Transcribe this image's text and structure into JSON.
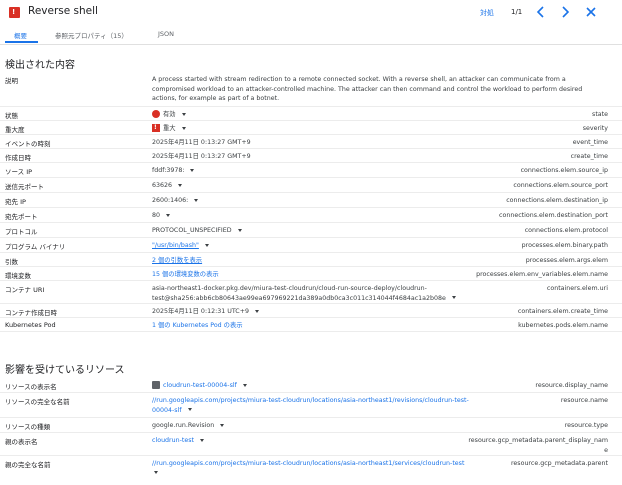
{
  "header": {
    "severity_glyph": "!",
    "title": "Reverse shell",
    "action_link": "対処",
    "pager": "1/1"
  },
  "tabs": [
    {
      "label": "概要"
    },
    {
      "label": "参照元プロパティ（15）"
    },
    {
      "label": "JSON"
    }
  ],
  "details": {
    "title": "検出された内容",
    "rows": [
      {
        "label": "説明",
        "value": "A process started with stream redirection to a remote connected socket. With a reverse shell, an attacker can communicate from a compromised workload to an attacker-controlled machine. The attacker can then command and control the workload to perform desired actions, for example as part of a botnet.",
        "field": ""
      },
      {
        "label": "状態",
        "value": "有効",
        "field": "state"
      },
      {
        "label": "重大度",
        "value": "重大",
        "field": "severity"
      },
      {
        "label": "イベントの時刻",
        "value": "2025年4月11日 0:13:27 GMT+9",
        "field": "event_time"
      },
      {
        "label": "作成日時",
        "value": "2025年4月11日 0:13:27 GMT+9",
        "field": "create_time"
      },
      {
        "label": "ソース IP",
        "value": "fddf:3978:",
        "field": "connections.elem.source_ip"
      },
      {
        "label": "送信元ポート",
        "value": "63626",
        "field": "connections.elem.source_port"
      },
      {
        "label": "宛先 IP",
        "value": "2600:1406:",
        "field": "connections.elem.destination_ip"
      },
      {
        "label": "宛先ポート",
        "value": "80",
        "field": "connections.elem.destination_port"
      },
      {
        "label": "プロトコル",
        "value": "PROTOCOL_UNSPECIFIED",
        "field": "connections.elem.protocol"
      },
      {
        "label": "プログラム バイナリ",
        "value": "\"/usr/bin/bash\"",
        "field": "processes.elem.binary.path"
      },
      {
        "label": "引数",
        "value": "2 個の引数を表示",
        "field": "processes.elem.args.elem"
      },
      {
        "label": "環境変数",
        "value": "15 個の環境変数の表示",
        "field": "processes.elem.env_variables.elem.name"
      },
      {
        "label": "コンテナ URI",
        "value_line1": "asia-northeast1-docker.pkg.dev/miura-test-cloudrun/cloud-run-source-deploy/cloudrun-",
        "value_line2": "test@sha256:abb6cb80643ae99ea697969221da389a0db0ca3c011c314044f4684ac1a2b08e",
        "field": "containers.elem.uri"
      },
      {
        "label": "コンテナ作成日時",
        "value": "2025年4月11日 0:12:31 UTC+9",
        "field": "containers.elem.create_time"
      },
      {
        "label": "Kubernetes Pod",
        "value": "1 個の Kubernetes Pod の表示",
        "field": "kubernetes.pods.elem.name"
      }
    ]
  },
  "resource": {
    "title": "影響を受けているリソース",
    "rows": [
      {
        "label": "リソースの表示名",
        "value": "cloudrun-test-00004-slf",
        "field": "resource.display_name"
      },
      {
        "label": "リソースの完全な名前",
        "value_line1": "//run.googleapis.com/projects/miura-test-cloudrun/locations/asia-northeast1/revisions/cloudrun-test-",
        "value_line2": "00004-slf",
        "field": "resource.name"
      },
      {
        "label": "リソースの種類",
        "value": "google.run.Revision",
        "field": "resource.type"
      },
      {
        "label": "親の表示名",
        "value": "cloudrun-test",
        "field_line1": "resource.gcp_metadata.parent_display_nam",
        "field_line2": "e"
      },
      {
        "label": "親の完全な名前",
        "value": "//run.googleapis.com/projects/miura-test-cloudrun/locations/asia-northeast1/services/cloudrun-test",
        "field": "resource.gcp_metadata.parent"
      }
    ]
  },
  "icons": {
    "prev": "chevron-left-icon",
    "next": "chevron-right-icon",
    "close": "close-icon"
  },
  "colors": {
    "accent": "#1a73e8",
    "critical": "#d93025"
  }
}
